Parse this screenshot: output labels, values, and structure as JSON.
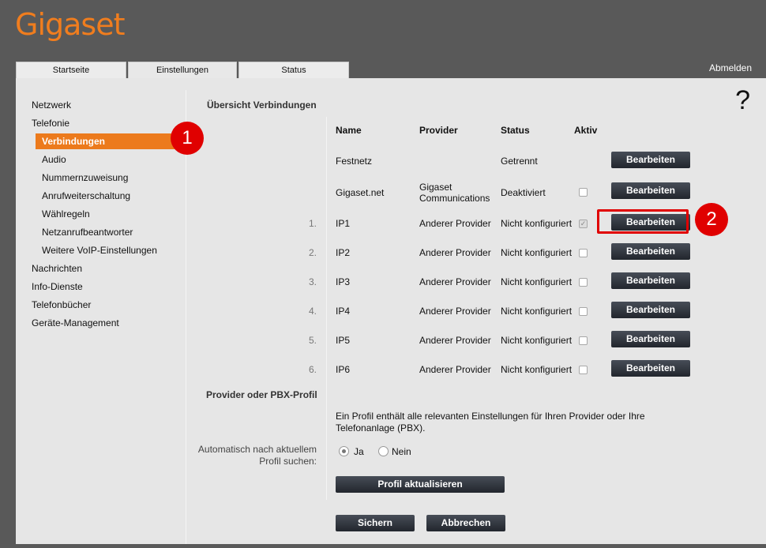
{
  "brand": {
    "name": "Gigaset",
    "color": "#f07d1e"
  },
  "tabs": [
    {
      "label": "Startseite"
    },
    {
      "label": "Einstellungen"
    },
    {
      "label": "Status"
    }
  ],
  "logout_label": "Abmelden",
  "help_label": "?",
  "sidebar": {
    "items": [
      {
        "label": "Netzwerk"
      },
      {
        "label": "Telefonie"
      },
      {
        "label": "Verbindungen"
      },
      {
        "label": "Audio"
      },
      {
        "label": "Nummernzuweisung"
      },
      {
        "label": "Anrufweiterschaltung"
      },
      {
        "label": "Wählregeln"
      },
      {
        "label": "Netzanrufbeantworter"
      },
      {
        "label": "Weitere VoIP-Einstellungen"
      },
      {
        "label": "Nachrichten"
      },
      {
        "label": "Info-Dienste"
      },
      {
        "label": "Telefonbücher"
      },
      {
        "label": "Geräte-Management"
      }
    ]
  },
  "callouts": [
    "1",
    "2"
  ],
  "connections": {
    "title": "Übersicht Verbindungen",
    "headers": {
      "name": "Name",
      "provider": "Provider",
      "status": "Status",
      "active": "Aktiv"
    },
    "edit_label": "Bearbeiten",
    "rows": [
      {
        "num": "",
        "name": "Festnetz",
        "provider": "",
        "status": "Getrennt",
        "has_checkbox": false,
        "checked": false
      },
      {
        "num": "",
        "name": "Gigaset.net",
        "provider_line1": "Gigaset",
        "provider_line2": "Communications",
        "status": "Deaktiviert",
        "has_checkbox": true,
        "checked": false
      },
      {
        "num": "1.",
        "name": "IP1",
        "provider": "Anderer Provider",
        "status": "Nicht konfiguriert",
        "has_checkbox": true,
        "checked": true
      },
      {
        "num": "2.",
        "name": "IP2",
        "provider": "Anderer Provider",
        "status": "Nicht konfiguriert",
        "has_checkbox": true,
        "checked": false
      },
      {
        "num": "3.",
        "name": "IP3",
        "provider": "Anderer Provider",
        "status": "Nicht konfiguriert",
        "has_checkbox": true,
        "checked": false
      },
      {
        "num": "4.",
        "name": "IP4",
        "provider": "Anderer Provider",
        "status": "Nicht konfiguriert",
        "has_checkbox": true,
        "checked": false
      },
      {
        "num": "5.",
        "name": "IP5",
        "provider": "Anderer Provider",
        "status": "Nicht konfiguriert",
        "has_checkbox": true,
        "checked": false
      },
      {
        "num": "6.",
        "name": "IP6",
        "provider": "Anderer Provider",
        "status": "Nicht konfiguriert",
        "has_checkbox": true,
        "checked": false
      }
    ]
  },
  "profile": {
    "title": "Provider oder PBX-Profil",
    "description_line1": "Ein Profil enthält alle relevanten Einstellungen für Ihren Provider oder Ihre",
    "description_line2": "Telefonanlage (PBX).",
    "auto_label_line1": "Automatisch nach aktuellem",
    "auto_label_line2": "Profil suchen:",
    "yes_label": "Ja",
    "no_label": "Nein",
    "selected": "Ja",
    "update_button": "Profil aktualisieren"
  },
  "footer": {
    "save_label": "Sichern",
    "cancel_label": "Abbrechen"
  },
  "colors": {
    "accent": "#ec7a1c",
    "callout": "#e00000",
    "button": "#2d323a"
  }
}
